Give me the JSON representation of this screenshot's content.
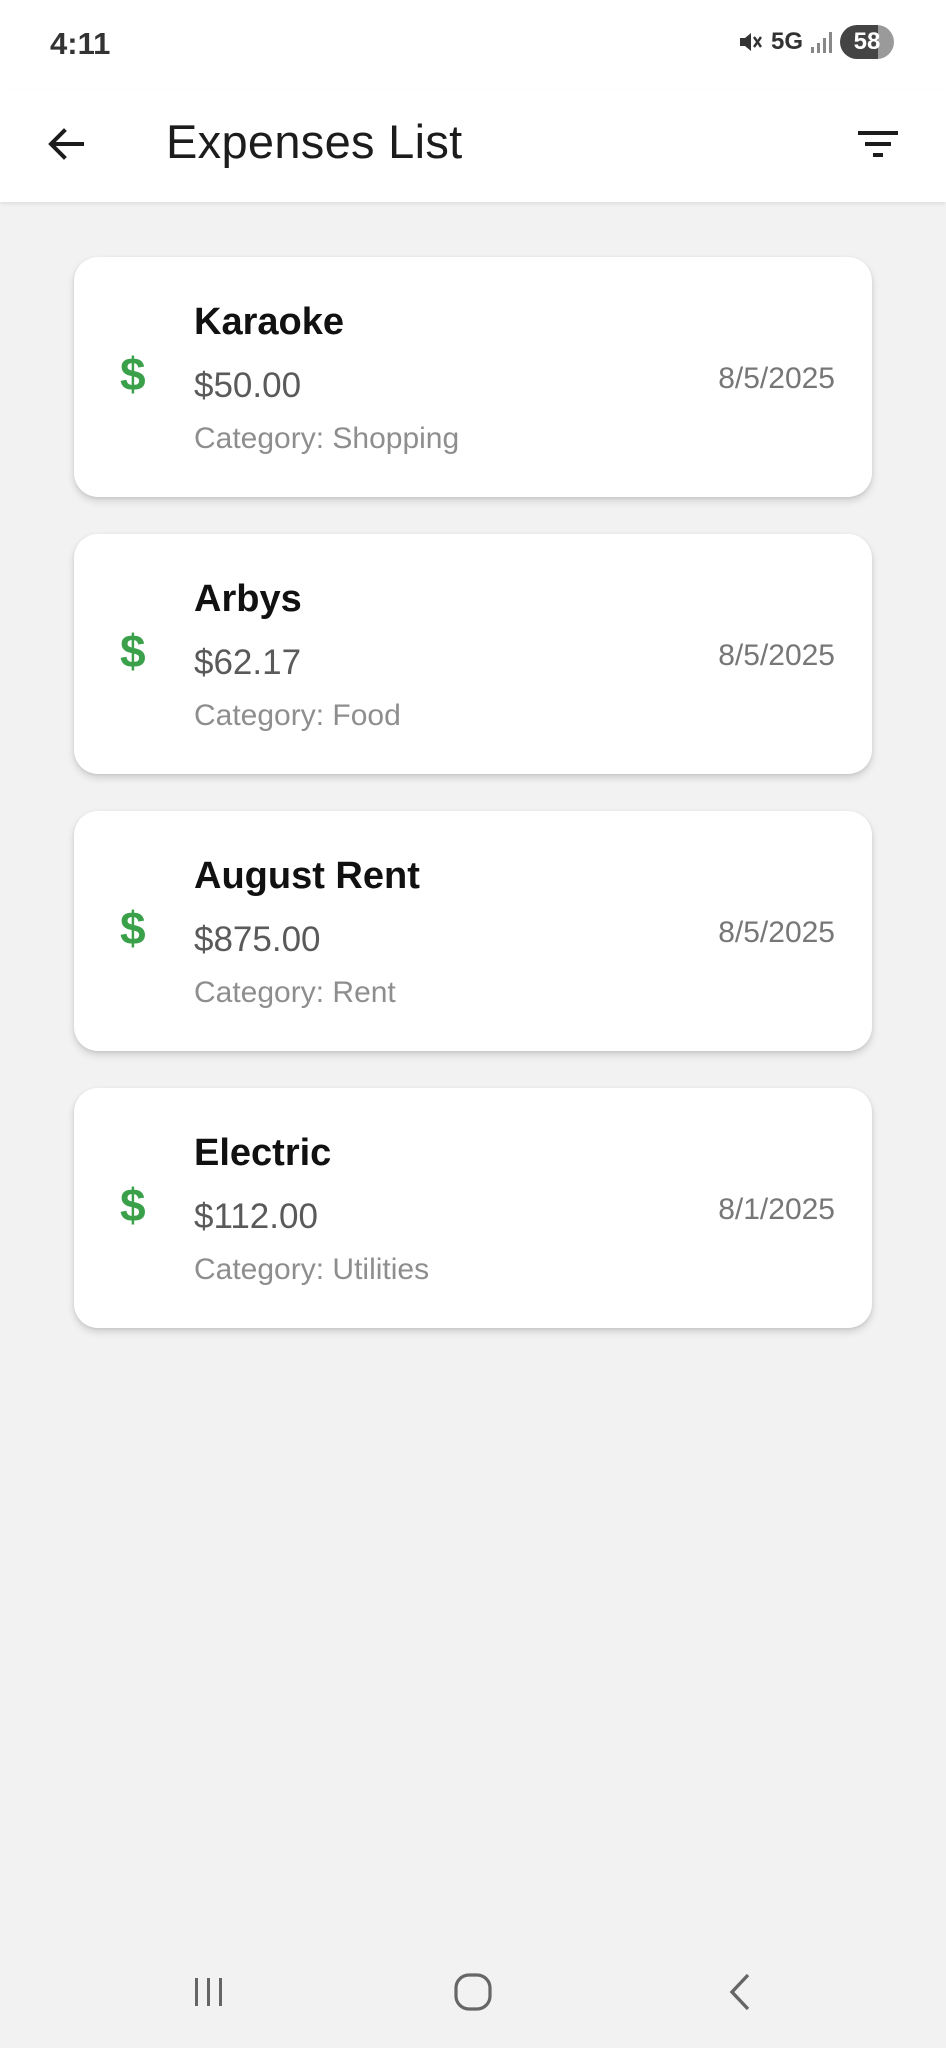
{
  "status_bar": {
    "time": "4:11",
    "network": "5G",
    "battery": "58"
  },
  "header": {
    "title": "Expenses List"
  },
  "expenses": [
    {
      "name": "Karaoke",
      "amount": "$50.00",
      "category": "Category: Shopping",
      "date": "8/5/2025",
      "icon": "$"
    },
    {
      "name": "Arbys",
      "amount": "$62.17",
      "category": "Category: Food",
      "date": "8/5/2025",
      "icon": "$"
    },
    {
      "name": "August Rent",
      "amount": "$875.00",
      "category": "Category: Rent",
      "date": "8/5/2025",
      "icon": "$"
    },
    {
      "name": "Electric",
      "amount": "$112.00",
      "category": "Category: Utilities",
      "date": "8/1/2025",
      "icon": "$"
    }
  ],
  "colors": {
    "accent_green": "#3aa14a",
    "background": "#f2f2f2"
  },
  "icons": {
    "back": "arrow-left-icon",
    "filter": "filter-icon",
    "expense": "dollar-icon",
    "nav_recents": "recents-icon",
    "nav_home": "home-icon",
    "nav_back": "chevron-left-icon"
  }
}
